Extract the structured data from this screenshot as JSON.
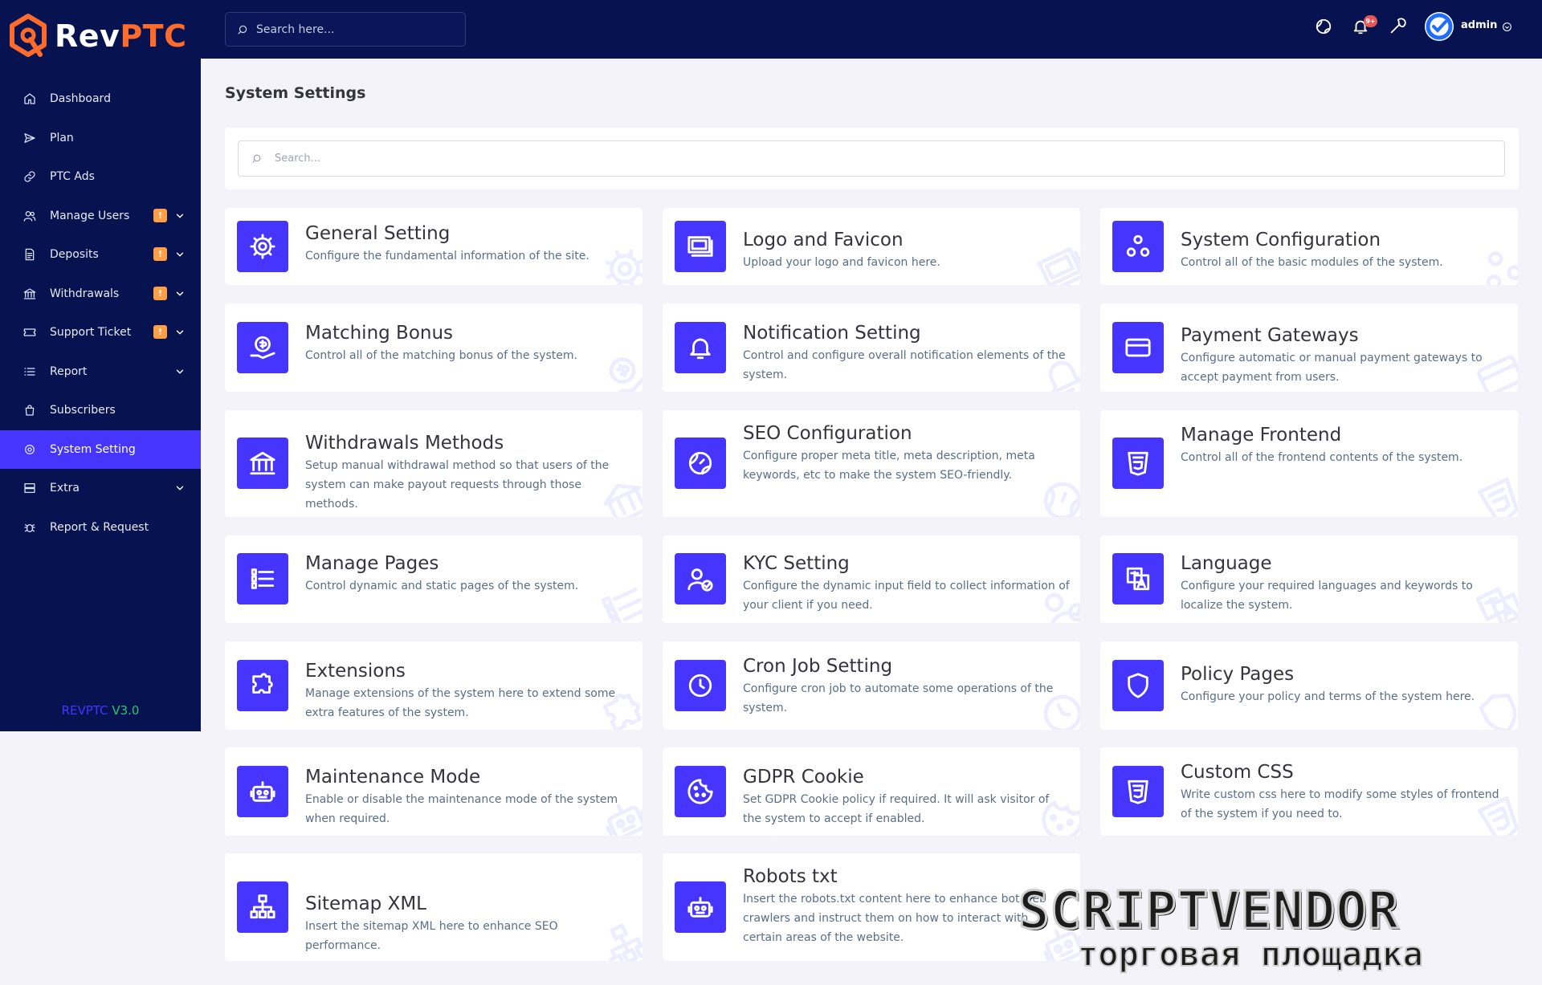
{
  "brand": {
    "logo_main": "Rev",
    "logo_accent": "PTC",
    "accent_color": "#ff6b2b"
  },
  "topbar": {
    "search_placeholder": "Search here...",
    "notification_count": "9+",
    "admin_name": "admin"
  },
  "sidebar": {
    "items": [
      {
        "label": "Dashboard",
        "icon": "home-icon"
      },
      {
        "label": "Plan",
        "icon": "send-icon"
      },
      {
        "label": "PTC Ads",
        "icon": "link-icon"
      },
      {
        "label": "Manage Users",
        "icon": "users-icon",
        "badge": "!",
        "has_submenu": true
      },
      {
        "label": "Deposits",
        "icon": "file-invoice-icon",
        "badge": "!",
        "has_submenu": true
      },
      {
        "label": "Withdrawals",
        "icon": "bank-icon",
        "badge": "!",
        "has_submenu": true
      },
      {
        "label": "Support Ticket",
        "icon": "ticket-icon",
        "badge": "!",
        "has_submenu": true
      },
      {
        "label": "Report",
        "icon": "list-icon",
        "has_submenu": true
      },
      {
        "label": "Subscribers",
        "icon": "bag-icon"
      },
      {
        "label": "System Setting",
        "icon": "gear-icon",
        "active": true
      },
      {
        "label": "Extra",
        "icon": "server-icon",
        "has_submenu": true
      },
      {
        "label": "Report & Request",
        "icon": "bug-icon"
      }
    ],
    "version_name": "REVPTC",
    "version_number": "V3.0"
  },
  "main": {
    "title": "System Settings",
    "search_placeholder": "Search...",
    "cards": [
      {
        "title": "General Setting",
        "description": "Configure the fundamental information of the site.",
        "icon": "gear-icon"
      },
      {
        "title": "Logo and Favicon",
        "description": "Upload your logo and favicon here.",
        "icon": "images-icon"
      },
      {
        "title": "System Configuration",
        "description": "Control all of the basic modules of the system.",
        "icon": "cogs-icon"
      },
      {
        "title": "Matching Bonus",
        "description": "Control all of the matching bonus of the system.",
        "icon": "money-hand-icon"
      },
      {
        "title": "Notification Setting",
        "description": "Control and configure overall notification elements of the system.",
        "icon": "bell-icon"
      },
      {
        "title": "Payment Gateways",
        "description": "Configure automatic or manual payment gateways to accept payment from users.",
        "icon": "credit-card-icon"
      },
      {
        "title": "Withdrawals Methods",
        "description": "Setup manual withdrawal method so that users of the system can make payout requests through those methods.",
        "icon": "bank-icon"
      },
      {
        "title": "SEO Configuration",
        "description": "Configure proper meta title, meta description, meta keywords, etc to make the system SEO-friendly.",
        "icon": "globe-icon"
      },
      {
        "title": "Manage Frontend",
        "description": "Control all of the frontend contents of the system.",
        "icon": "html5-icon"
      },
      {
        "title": "Manage Pages",
        "description": "Control dynamic and static pages of the system.",
        "icon": "list-icon"
      },
      {
        "title": "KYC Setting",
        "description": "Configure the dynamic input field to collect information of your client if you need.",
        "icon": "user-check-icon"
      },
      {
        "title": "Language",
        "description": "Configure your required languages and keywords to localize the system.",
        "icon": "language-icon"
      },
      {
        "title": "Extensions",
        "description": "Manage extensions of the system here to extend some extra features of the system.",
        "icon": "puzzle-icon"
      },
      {
        "title": "Cron Job Setting",
        "description": "Configure cron job to automate some operations of the system.",
        "icon": "clock-icon"
      },
      {
        "title": "Policy Pages",
        "description": "Configure your policy and terms of the system here.",
        "icon": "shield-icon"
      },
      {
        "title": "Maintenance Mode",
        "description": "Enable or disable the maintenance mode of the system when required.",
        "icon": "robot-icon"
      },
      {
        "title": "GDPR Cookie",
        "description": "Set GDPR Cookie policy if required. It will ask visitor of the system to accept if enabled.",
        "icon": "cookie-icon"
      },
      {
        "title": "Custom CSS",
        "description": "Write custom css here to modify some styles of frontend of the system if you need to.",
        "icon": "css3-icon"
      },
      {
        "title": "Sitemap XML",
        "description": "Insert the sitemap XML here to enhance SEO performance.",
        "icon": "sitemap-icon"
      },
      {
        "title": "Robots txt",
        "description": "Insert the robots.txt content here to enhance bot web crawlers and instruct them on how to interact with certain areas of the website.",
        "icon": "robot-icon"
      }
    ]
  },
  "watermark": {
    "line1": "SCRIPTVENDOR",
    "line2": "торговая площадка"
  },
  "colors": {
    "primary": "#4634ff",
    "sidebar_bg": "#071251",
    "badge": "#ff9f43",
    "page_bg": "#f3f3f9"
  }
}
